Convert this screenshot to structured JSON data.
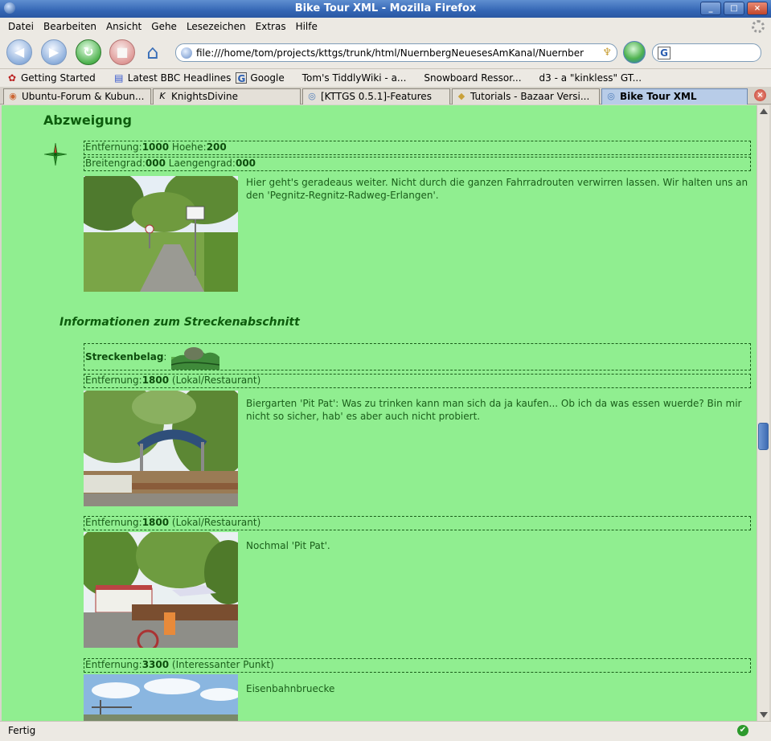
{
  "window": {
    "title": "Bike Tour XML - Mozilla Firefox",
    "controls": [
      "_",
      "□",
      "×"
    ]
  },
  "menu": [
    "Datei",
    "Bearbeiten",
    "Ansicht",
    "Gehe",
    "Lesezeichen",
    "Extras",
    "Hilfe"
  ],
  "nav": {
    "back_glyph": "◀",
    "forward_glyph": "▶",
    "reload_glyph": "↻",
    "stop_glyph": "■",
    "home_glyph": "⌂",
    "url": "file:///home/tom/projects/kttgs/trunk/html/NuernbergNeuesesAmKanal/Nuernber",
    "feed_glyph": "♆",
    "search_engine_glyph": "G"
  },
  "bookmarks": [
    {
      "icon": "✿",
      "label": "Getting Started"
    },
    {
      "icon": "▤",
      "label": "Latest BBC Headlines"
    },
    {
      "icon": "G",
      "label": "Google"
    },
    {
      "icon": "",
      "label": "Tom's TiddlyWiki - a..."
    },
    {
      "icon": "",
      "label": "Snowboard Ressor..."
    },
    {
      "icon": "",
      "label": "d3 - a \"kinkless\" GT..."
    }
  ],
  "tabs": [
    {
      "icon": "◉",
      "label": "Ubuntu-Forum & Kubun..."
    },
    {
      "icon": "K",
      "label": "KnightsDivine"
    },
    {
      "icon": "◎",
      "label": "[KTTGS 0.5.1]-Features"
    },
    {
      "icon": "◆",
      "label": "Tutorials - Bazaar Versi..."
    },
    {
      "icon": "◎",
      "label": "Bike Tour XML"
    }
  ],
  "tab_close_glyph": "×",
  "page": {
    "section_heading": "Abzweigung",
    "waypoint": {
      "dist_label": "Entfernung:",
      "dist_value": "1000",
      "height_label": " Hoehe:",
      "height_value": "200",
      "lat_label": "Breitengrad:",
      "lat_value": "000",
      "lon_label": " Laengengrad:",
      "lon_value": "000",
      "description": "Hier geht's geradeaus weiter. Nicht durch die ganzen Fahrradrouten verwirren lassen. Wir halten uns an den 'Pegnitz-Regnitz-Radweg-Erlangen'."
    },
    "info_heading": "Informationen zum Streckenabschnitt",
    "surface_label": "Streckenbelag",
    "surface_sep": ":",
    "points": [
      {
        "dist_label": "Entfernung:",
        "dist_value": "1800",
        "type": " (Lokal/Restaurant)",
        "description": "Biergarten 'Pit Pat': Was zu trinken kann man sich da ja kaufen... Ob ich da was essen wuerde? Bin mir nicht so sicher, hab' es aber auch nicht probiert."
      },
      {
        "dist_label": "Entfernung:",
        "dist_value": "1800",
        "type": " (Lokal/Restaurant)",
        "description": "Nochmal 'Pit Pat'."
      },
      {
        "dist_label": "Entfernung:",
        "dist_value": "3300",
        "type": " (Interessanter Punkt)",
        "description": "Eisenbahnbruecke"
      }
    ]
  },
  "status": {
    "text": "Fertig",
    "ok_glyph": "✔"
  }
}
